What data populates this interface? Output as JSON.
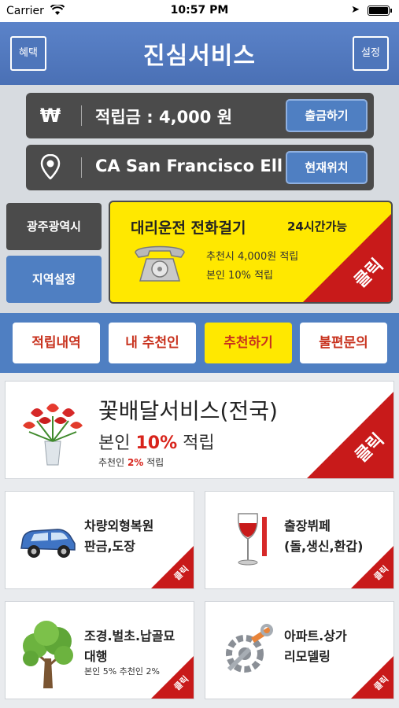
{
  "status_bar": {
    "carrier": "Carrier",
    "time": "10:57 PM"
  },
  "header": {
    "title": "진심서비스",
    "left_button": "혜택",
    "right_button": "설정"
  },
  "points_row": {
    "currency_symbol": "₩",
    "label": "적립금 : 4,000 원",
    "button": "출금하기"
  },
  "location_row": {
    "value": "CA  San Francisco  Ell",
    "button": "현재위치"
  },
  "region": {
    "city": "광주광역시",
    "setting_button": "지역설정"
  },
  "driver_card": {
    "title": "대리운전 전화걸기",
    "hours": "24시간가능",
    "line1": "추천시 4,000원 적립",
    "line2": "본인 10% 적립",
    "corner": "클릭"
  },
  "tabs": [
    {
      "label": "적립내역"
    },
    {
      "label": "내 추천인"
    },
    {
      "label": "추천하기"
    },
    {
      "label": "불편문의"
    }
  ],
  "flower_card": {
    "title": "꽃배달서비스(전국)",
    "sub_prefix": "본인 ",
    "sub_percent": "10%",
    "sub_suffix": " 적립",
    "small_prefix": "추천인 ",
    "small_percent": "2%",
    "small_suffix": " 적립",
    "corner": "클릭"
  },
  "services": [
    {
      "line1": "차량외형복원",
      "line2": "판금,도장",
      "line3": "",
      "corner": "클릭",
      "icon": "car-icon"
    },
    {
      "line1": "출장뷔페",
      "line2": "(돌,생신,환갑)",
      "line3": "",
      "corner": "클릭",
      "icon": "wine-glass-icon"
    },
    {
      "line1": "조경.벌초.납골묘",
      "line2": "대행",
      "line3": "본인 5% 추천인 2%",
      "corner": "클릭",
      "icon": "tree-icon"
    },
    {
      "line1": "아파트.상가",
      "line2": "리모델링",
      "line3": "",
      "corner": "클릭",
      "icon": "tools-icon"
    }
  ],
  "colors": {
    "header_blue": "#4f7fc2",
    "dark_gray": "#4b4b4b",
    "yellow": "#ffe800",
    "red": "#c81a1a"
  }
}
